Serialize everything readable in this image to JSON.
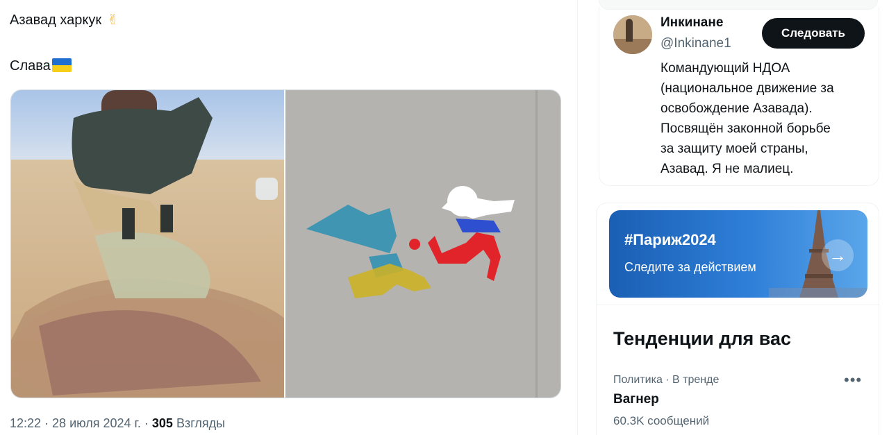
{
  "tweet": {
    "line1": "Азавад харкук",
    "line1_emoji": "✌",
    "line2": "Слава",
    "meta_time": "12:22 · 28 июля 2024 г. · ",
    "meta_views_count": "305",
    "meta_views_label": " Взгляды"
  },
  "profile": {
    "name": "Инкинане",
    "handle": "@Inkinane1",
    "follow_label": "Следовать",
    "bio": "Командующий НДОА\n(национальное движение за\nосвобождение Азавада).\nПосвящён законной борьбе\nза защиту моей страны,\nАзавад. Я не малиец."
  },
  "promo": {
    "title": "#Париж2024",
    "subtitle": "Следите за действием"
  },
  "trends": {
    "title": "Тенденции для вас",
    "items": [
      {
        "category": "Политика · В тренде",
        "name": "Вагнер",
        "count": "60.3K сообщений"
      }
    ]
  },
  "colors": {
    "text_primary": "#0f1419",
    "text_secondary": "#536471",
    "follow_bg": "#0f1419",
    "flag_blue": "#1f6fd0",
    "flag_yellow": "#f7cf1a"
  },
  "icons": [
    "victory-hand-icon",
    "ukraine-flag-icon",
    "arrow-right-icon",
    "more-horizontal-icon"
  ]
}
